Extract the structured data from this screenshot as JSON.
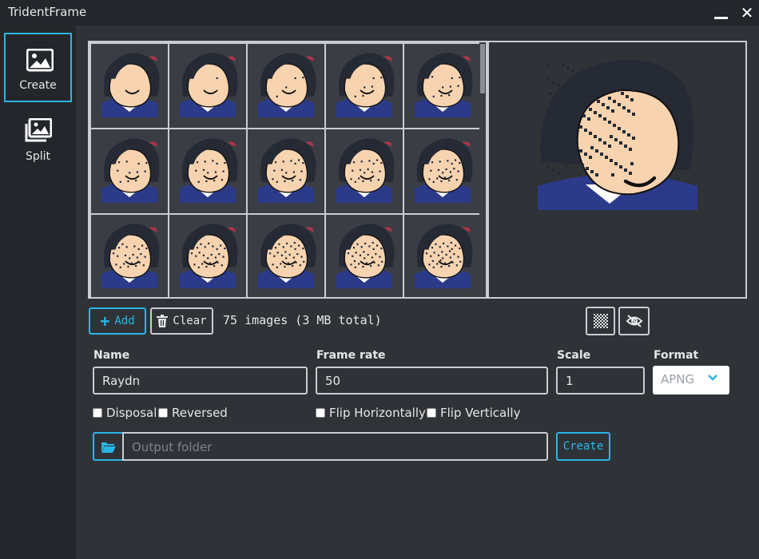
{
  "app": {
    "title": "TridentFrame"
  },
  "sidebar": {
    "items": [
      {
        "label": "Create",
        "icon": "image-icon",
        "active": true
      },
      {
        "label": "Split",
        "icon": "images-icon",
        "active": false
      }
    ]
  },
  "toolbar": {
    "add_label": "Add",
    "clear_label": "Clear",
    "summary": "75 images (3 MB total)"
  },
  "form": {
    "name": {
      "label": "Name",
      "value": "Raydn"
    },
    "frame_rate": {
      "label": "Frame rate",
      "value": "50"
    },
    "scale": {
      "label": "Scale",
      "value": "1"
    },
    "format": {
      "label": "Format",
      "value": "APNG"
    },
    "checkboxes": [
      {
        "label": "Disposal",
        "checked": false
      },
      {
        "label": "Reversed",
        "checked": false
      },
      {
        "label": "Flip Horizontally",
        "checked": false
      },
      {
        "label": "Flip Vertically",
        "checked": false
      }
    ],
    "output_placeholder": "Output folder",
    "create_label": "Create"
  },
  "colors": {
    "accent": "#29b6e6",
    "background": "#2f3338",
    "sidebar": "#23272b"
  }
}
